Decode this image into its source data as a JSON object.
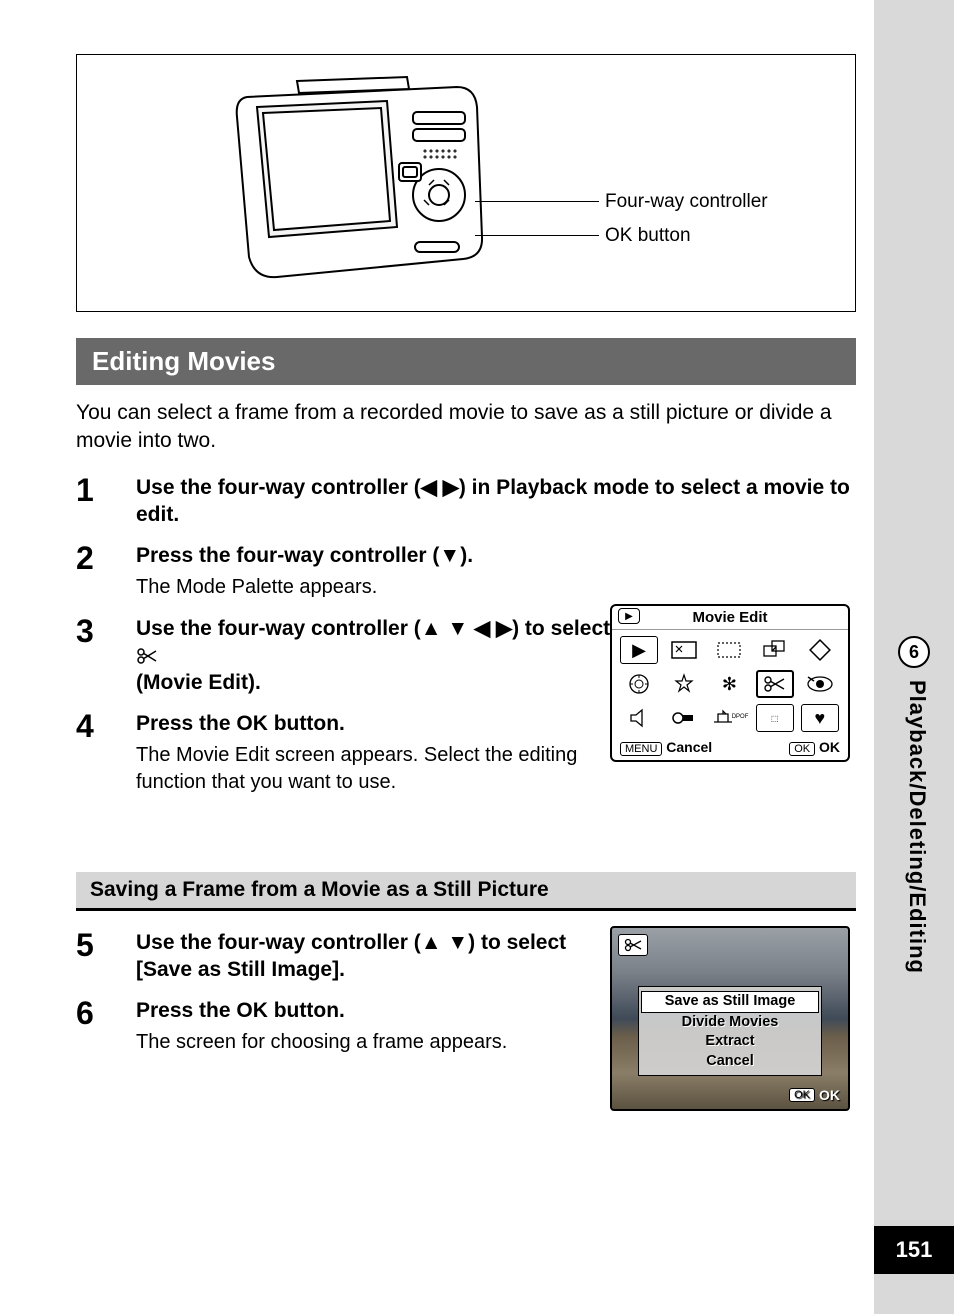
{
  "page_number": "151",
  "chapter": {
    "number": "6",
    "title": "Playback/Deleting/Editing"
  },
  "diagram": {
    "callout1": "Four-way controller",
    "callout2": "OK button"
  },
  "section_title": "Editing Movies",
  "intro": "You can select a frame from a recorded movie to save as a still picture or divide a movie into two.",
  "steps": [
    {
      "n": "1",
      "h_pre": "Use the four-way controller (",
      "h_arrows": "◀ ▶",
      "h_post": ") in Playback mode to select a movie to edit."
    },
    {
      "n": "2",
      "h_pre": "Press the four-way controller (",
      "h_arrows": "▼",
      "h_post": ").",
      "sub": "The Mode Palette appears."
    },
    {
      "n": "3",
      "h_pre": "Use the four-way controller (",
      "h_arrows": "▲ ▼ ◀ ▶",
      "h_post": ") to select ",
      "h_tail": "(Movie Edit)."
    },
    {
      "n": "4",
      "h": "Press the OK button.",
      "sub": "The Movie Edit screen appears. Select the editing function that you want to use."
    }
  ],
  "palette": {
    "title": "Movie Edit",
    "footer_left_key": "MENU",
    "footer_left": "Cancel",
    "footer_right_key": "OK",
    "footer_right": "OK"
  },
  "subsection_title": "Saving a Frame from a Movie as a Still Picture",
  "steps2": [
    {
      "n": "5",
      "h_pre": "Use the four-way controller (",
      "h_arrows": "▲ ▼",
      "h_post": ") to select [Save as Still Image]."
    },
    {
      "n": "6",
      "h": "Press the OK button.",
      "sub": "The screen for choosing a frame appears."
    }
  ],
  "menu": {
    "items": [
      "Save as Still Image",
      "Divide Movies",
      "Extract",
      "Cancel"
    ],
    "ok_key": "OK",
    "ok_label": "OK"
  }
}
